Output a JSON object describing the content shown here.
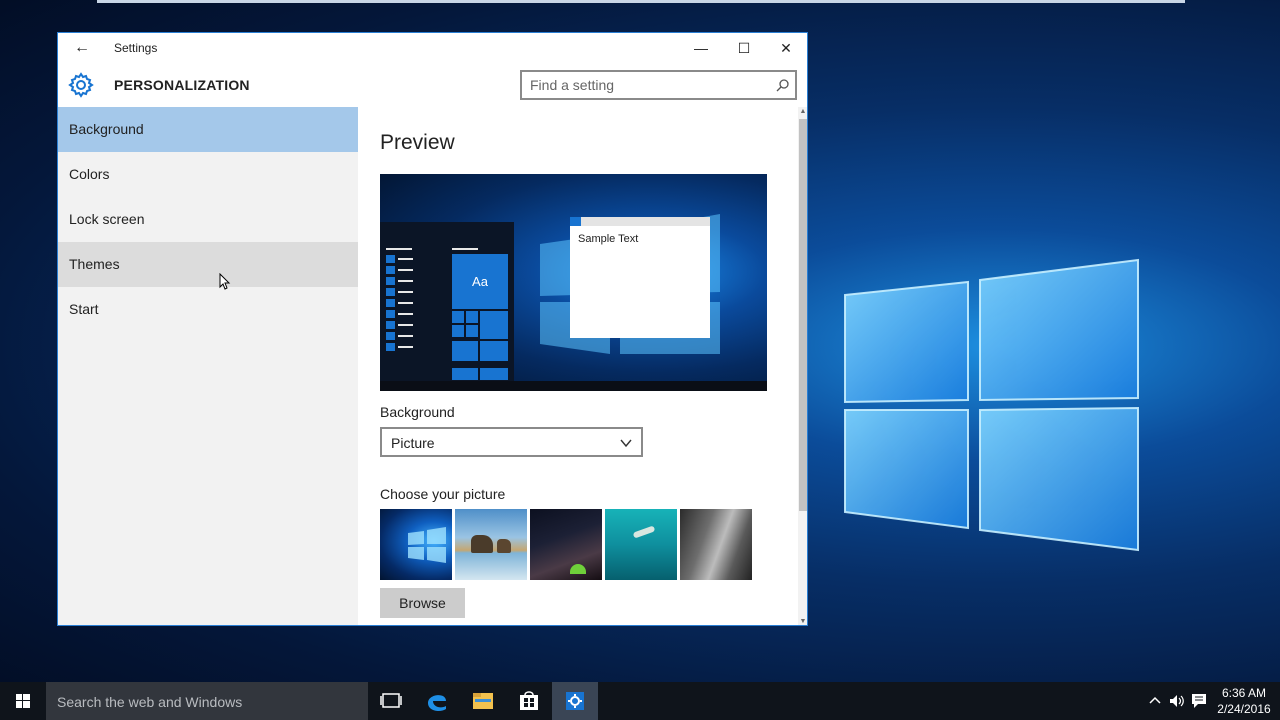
{
  "window": {
    "title": "Settings",
    "controls": {
      "minimize": "—",
      "maximize": "☐",
      "close": "✕"
    }
  },
  "header": {
    "title": "PERSONALIZATION",
    "search_placeholder": "Find a setting"
  },
  "sidebar": {
    "items": [
      {
        "label": "Background",
        "state": "selected"
      },
      {
        "label": "Colors",
        "state": "normal"
      },
      {
        "label": "Lock screen",
        "state": "normal"
      },
      {
        "label": "Themes",
        "state": "hover"
      },
      {
        "label": "Start",
        "state": "normal"
      }
    ]
  },
  "content": {
    "preview_title": "Preview",
    "preview_sample_text": "Sample Text",
    "preview_tile_text": "Aa",
    "background_label": "Background",
    "background_value": "Picture",
    "choose_label": "Choose your picture",
    "pictures": [
      "windows-hero",
      "beach-rocks",
      "night-sky",
      "underwater-swimmer",
      "rock-cliff"
    ],
    "browse_label": "Browse"
  },
  "taskbar": {
    "search_text": "Search the web and Windows",
    "apps": [
      "task-view-icon",
      "edge-icon",
      "file-explorer-icon",
      "store-icon",
      "settings-icon"
    ],
    "clock_time": "6:36 AM",
    "clock_date": "2/24/2016"
  },
  "colors": {
    "accent": "#1874d1",
    "selected_item": "#a4c8ea",
    "hover_item": "#dcdcdc"
  }
}
